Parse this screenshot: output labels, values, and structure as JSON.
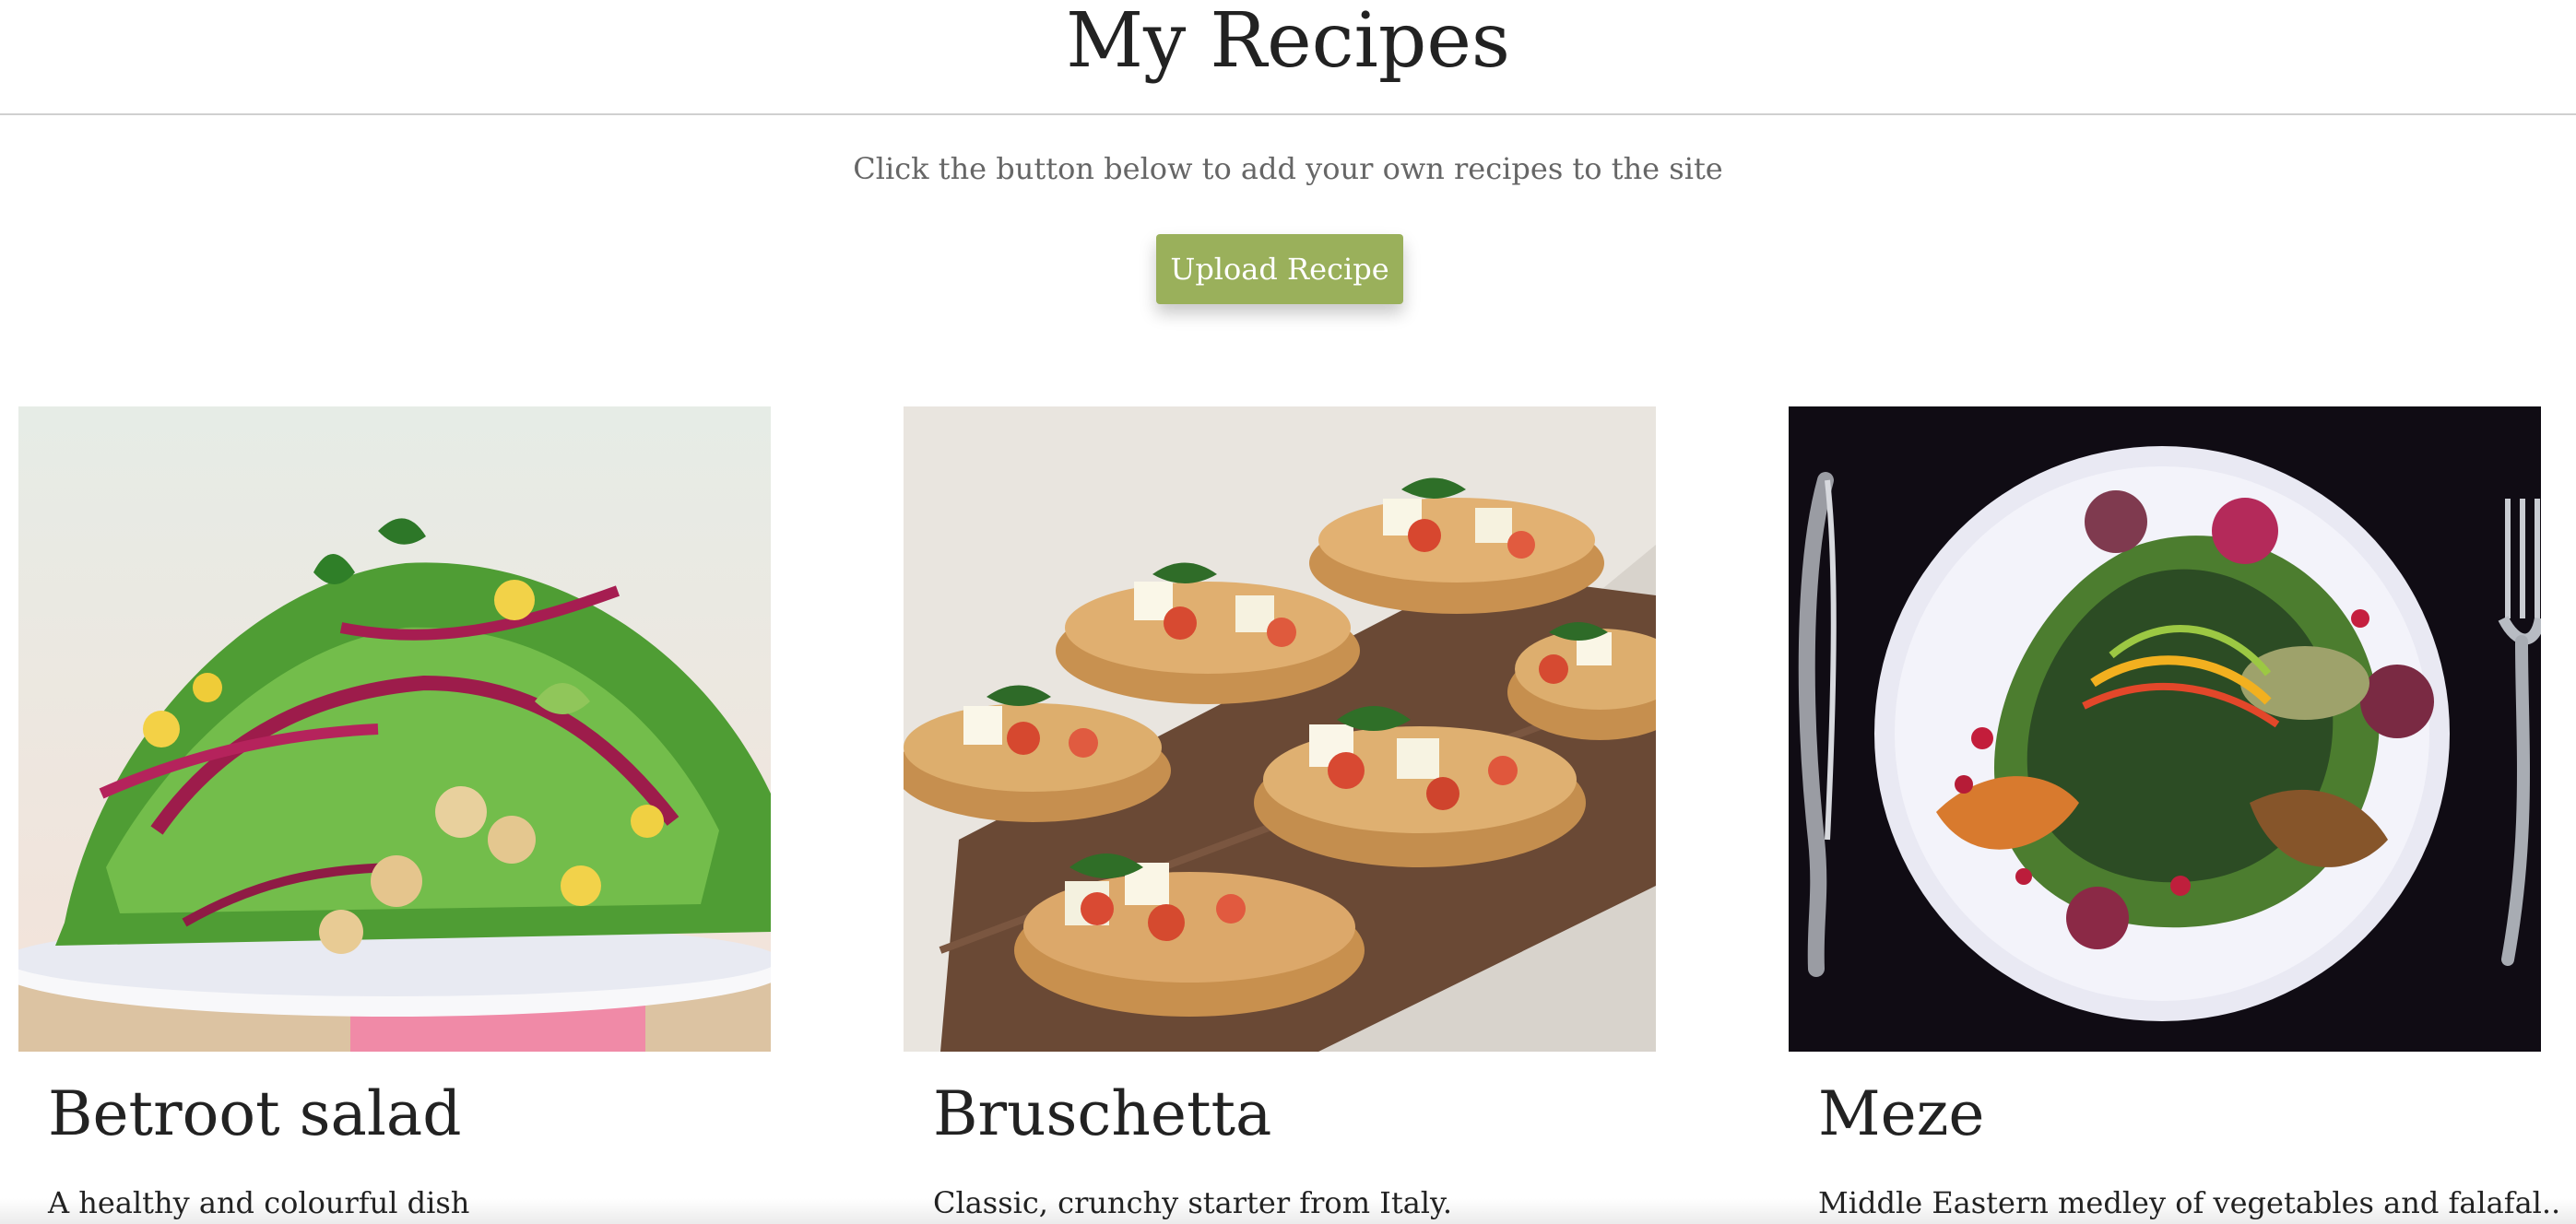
{
  "header": {
    "title": "My Recipes"
  },
  "intro": {
    "text": "Click the button below to add your own recipes to the site"
  },
  "actions": {
    "upload_label": "Upload Recipe"
  },
  "recipes": [
    {
      "title": "Betroot salad",
      "description": "A healthy and colourful dish"
    },
    {
      "title": "Bruschetta",
      "description": "Classic, crunchy starter from Italy."
    },
    {
      "title": "Meze",
      "description": "Middle Eastern medley of vegetables and falafal.."
    }
  ],
  "colors": {
    "accent": "#9ab05b",
    "text": "#222222",
    "muted_text": "#666666",
    "divider": "#d0d0d0"
  }
}
